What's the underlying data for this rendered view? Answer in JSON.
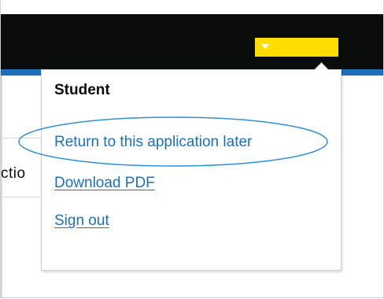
{
  "header": {
    "background_color": "#0b0c0c",
    "accent_color": "#ffdd00",
    "strip_color": "#1d70b8",
    "menu_toggle_icon": "chevron-down-icon"
  },
  "background": {
    "partial_text": "ctio"
  },
  "account_menu": {
    "user_name": "Student",
    "items": [
      {
        "label": "Return to this application later",
        "icon": ""
      },
      {
        "label": "Download PDF"
      },
      {
        "label": "Sign out"
      }
    ],
    "link_color": "#1d70b8",
    "highlight_color": "#2f8fd6"
  }
}
